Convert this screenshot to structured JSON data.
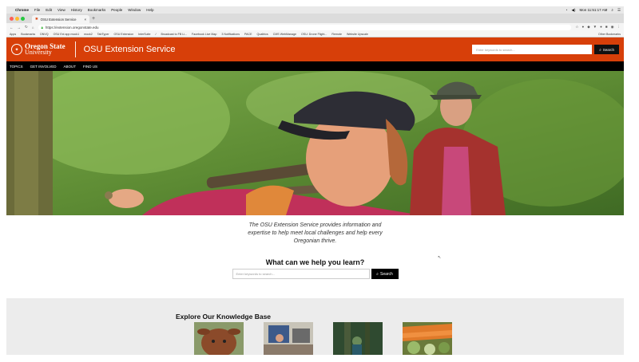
{
  "os_menu": {
    "app": "Chrome",
    "items": [
      "File",
      "Edit",
      "View",
      "History",
      "Bookmarks",
      "People",
      "Window",
      "Help"
    ],
    "clock": "Mon 11:51:17 AM"
  },
  "browser": {
    "tab_title": "OSU Extension Service",
    "url": "https://extension.oregonstate.edu",
    "bookmarks": [
      "Apps",
      "Bookmarks",
      "DNVQ",
      "OSU Ext app mock1",
      "mock2",
      "TabTyper",
      "OSU Extension",
      "InterSuite",
      "/",
      "Broadcast to FB Li...",
      "Facebook Live Map",
      "3 Notifications",
      "PACE",
      "Qualtrics",
      "CMS WebManage",
      "OSU: Drone Flight...",
      "Remote",
      "Website Upscale"
    ],
    "other_bookmarks": "Other Bookmarks"
  },
  "site": {
    "logo_line1": "Oregon State",
    "logo_line2": "University",
    "title": "OSU Extension Service",
    "search_placeholder": "Enter keywords to search...",
    "search_button": "Search",
    "nav": [
      "TOPICS",
      "GET INVOLVED",
      "ABOUT",
      "FIND US"
    ]
  },
  "intro": "The OSU Extension Service provides information and expertise to help meet local challenges and help every Oregonian thrive.",
  "help": {
    "title": "What can we help you learn?",
    "placeholder": "Enter keywords to search...",
    "button": "Search"
  },
  "knowledge": {
    "title": "Explore Our Knowledge Base"
  },
  "colors": {
    "brand_orange": "#d73f09",
    "nav_black": "#000000",
    "kb_background": "#ececec"
  }
}
